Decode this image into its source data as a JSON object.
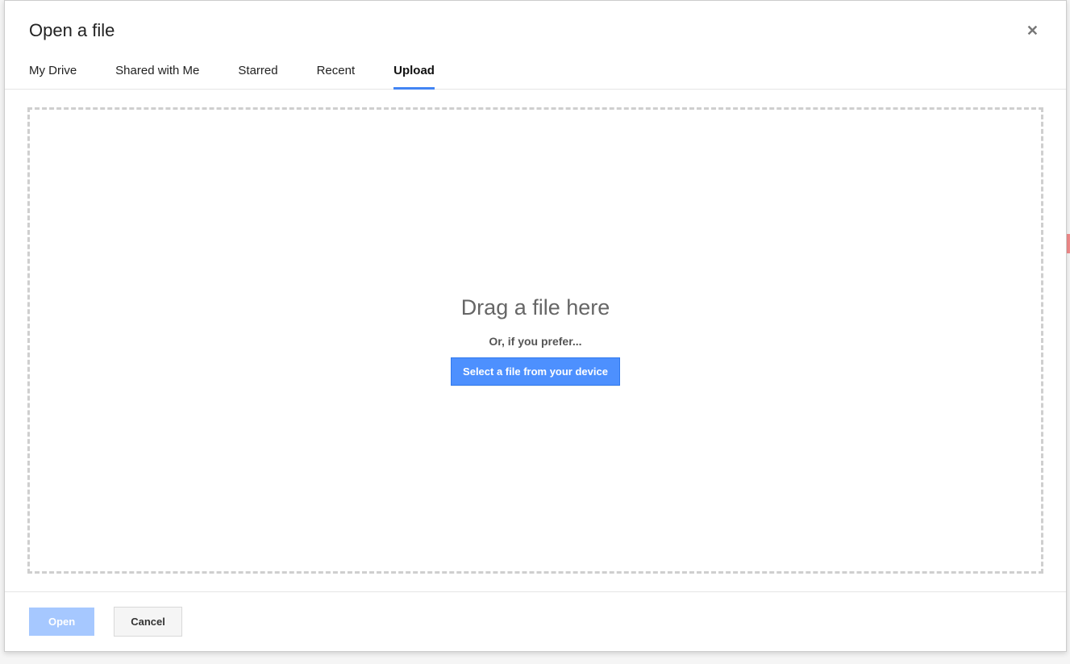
{
  "dialog": {
    "title": "Open a file"
  },
  "tabs": [
    {
      "label": "My Drive",
      "active": false
    },
    {
      "label": "Shared with Me",
      "active": false
    },
    {
      "label": "Starred",
      "active": false
    },
    {
      "label": "Recent",
      "active": false
    },
    {
      "label": "Upload",
      "active": true
    }
  ],
  "upload": {
    "drop_title": "Drag a file here",
    "drop_subtitle": "Or, if you prefer...",
    "select_button": "Select a file from your device"
  },
  "footer": {
    "open_label": "Open",
    "cancel_label": "Cancel"
  }
}
